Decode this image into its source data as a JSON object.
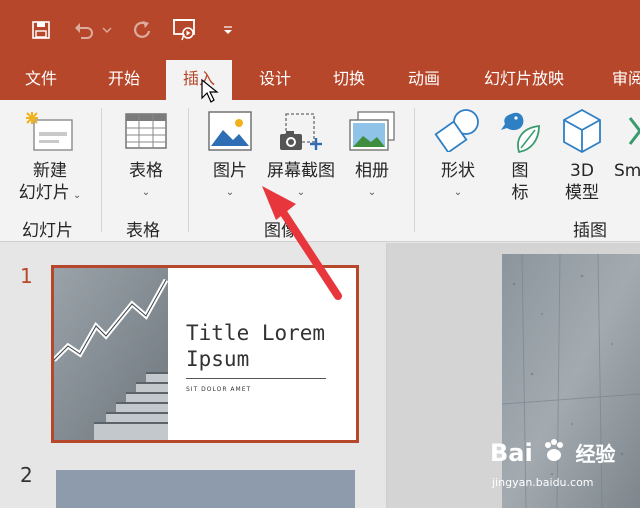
{
  "tabs": [
    {
      "label": "文件",
      "active": false
    },
    {
      "label": "开始",
      "active": false
    },
    {
      "label": "插入",
      "active": true
    },
    {
      "label": "设计",
      "active": false
    },
    {
      "label": "切换",
      "active": false
    },
    {
      "label": "动画",
      "active": false
    },
    {
      "label": "幻灯片放映",
      "active": false
    },
    {
      "label": "审阅",
      "active": false
    }
  ],
  "ribbon": {
    "new_slide": {
      "line1": "新建",
      "line2": "幻灯片"
    },
    "table": {
      "label": "表格"
    },
    "picture": {
      "label": "图片"
    },
    "screenshot": {
      "label": "屏幕截图"
    },
    "album": {
      "label": "相册"
    },
    "shapes": {
      "label": "形状"
    },
    "icons": {
      "line1": "图",
      "line2": "标"
    },
    "model3d": {
      "line1": "3D",
      "line2": "模型"
    },
    "smartart": {
      "label": "Sm"
    },
    "groups": {
      "slides": "幻灯片",
      "tables": "表格",
      "images": "图像",
      "illustrations": "插图"
    }
  },
  "slides": [
    {
      "number": "1",
      "title_line1": "Title Lorem",
      "title_line2": "Ipsum",
      "subtitle": "SIT DOLOR AMET"
    },
    {
      "number": "2"
    }
  ],
  "watermark": {
    "brand": "Bai",
    "brand2": "经验",
    "url": "jingyan.baidu.com"
  },
  "colors": {
    "accent": "#b7472a",
    "ribbon_bg": "#f3f3f3",
    "arrow": "#e8373c"
  }
}
